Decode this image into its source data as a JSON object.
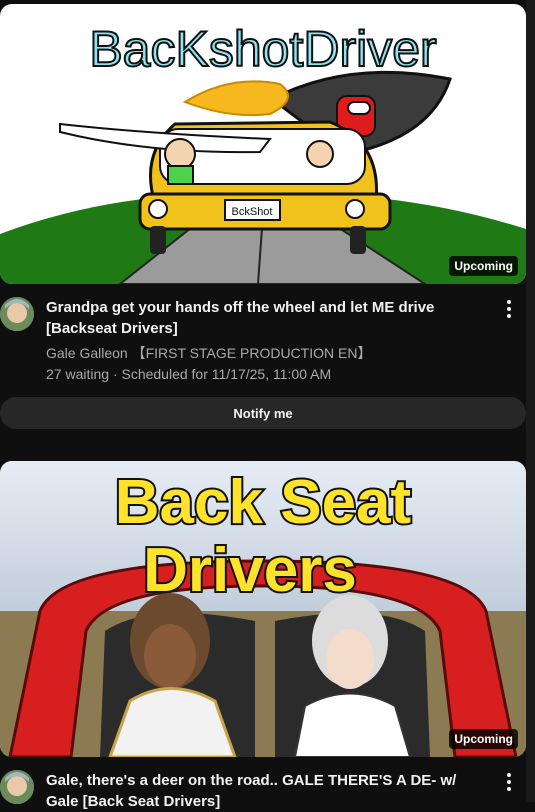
{
  "videos": [
    {
      "thumb_text": "BacKshotDriver",
      "plate_text": "BckShot",
      "badge": "Upcoming",
      "title": "Grandpa get your hands off the wheel and let ME drive [Backseat Drivers]",
      "channel": "Gale Galleon 【FIRST STAGE PRODUCTION EN】",
      "stats": "27 waiting · Scheduled for 11/17/25, 11:00 AM",
      "notify_label": "Notify me"
    },
    {
      "thumb_line1": "Back Seat",
      "thumb_line2": "Drivers",
      "badge": "Upcoming",
      "title": "Gale, there's a deer on the road.. GALE THERE'S A DE- w/ Gale [Back Seat Drivers]"
    }
  ],
  "colors": {
    "background": "#0f0f0f",
    "button_bg": "#272727",
    "secondary_text": "#aaaaaa"
  }
}
